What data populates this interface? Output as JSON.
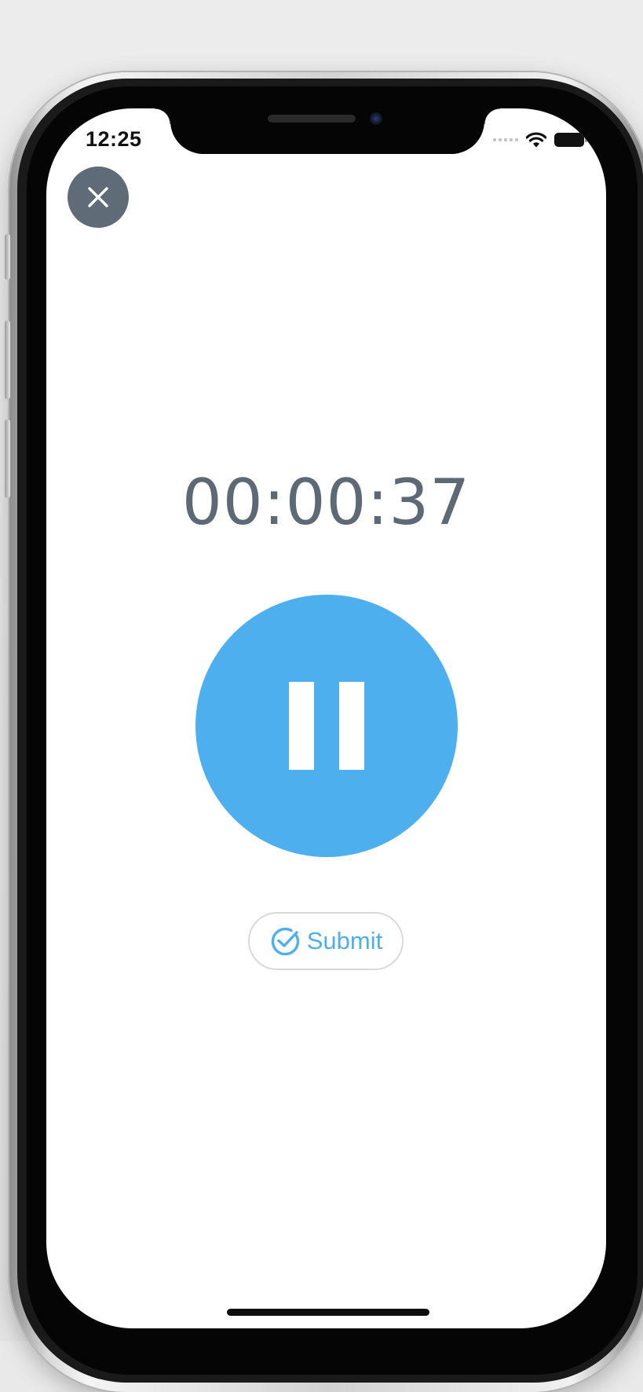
{
  "status_bar": {
    "time": "12:25",
    "icons": [
      "cellular-signal-icon",
      "wifi-icon",
      "battery-icon"
    ]
  },
  "recorder": {
    "close_icon": "close-icon",
    "timer": "00:00:37",
    "pause_icon": "pause-icon",
    "submit_label": "Submit",
    "submit_icon": "check-circle-icon"
  },
  "colors": {
    "accent": "#4eafee",
    "close_button": "#5f6b77",
    "timer_text": "#5e6976"
  }
}
